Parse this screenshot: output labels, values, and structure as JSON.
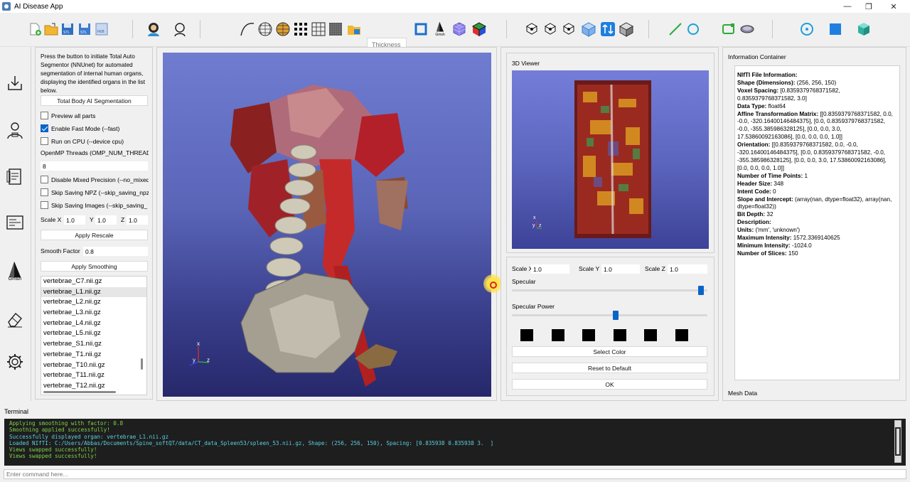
{
  "window": {
    "title": "AI Disease App",
    "controls": [
      "—",
      "❐",
      "✕"
    ]
  },
  "toolbar": {
    "thickness_placeholder": "Thickness",
    "gmsh_label": "Gmsh",
    "icons": [
      "new-file-icon",
      "open-folder-icon",
      "save-stl-icon",
      "save-stl-alt-icon",
      "save-feb-icon",
      "user-icon",
      "user-outline-icon",
      "spline-icon",
      "mesh-sphere-icon",
      "mesh-sphere-gold-icon",
      "voxel-grid-icon",
      "wireframe-grid-icon",
      "solid-grid-icon",
      "folder-open-icon",
      "crop-icon",
      "gmsh-icon",
      "cube-grid-icon",
      "color-cube-icon",
      "node-1-icon",
      "node-2-icon",
      "node-3-icon",
      "cube-icon",
      "swap-views-icon",
      "box-icon",
      "line-icon",
      "circle-icon",
      "rectangle-icon",
      "ellipse-icon",
      "target-icon",
      "square-icon",
      "cube-teal-icon"
    ]
  },
  "sidebar": {
    "items": [
      {
        "name": "download-icon"
      },
      {
        "name": "ai-doctor-icon"
      },
      {
        "name": "report-icon"
      },
      {
        "name": "log-icon"
      },
      {
        "name": "gmsh-icon",
        "label": "Gmsh"
      },
      {
        "name": "eraser-icon"
      },
      {
        "name": "settings-icon"
      }
    ]
  },
  "panel": {
    "description": "Press the button to initiate Total Auto Segmentor (NNUnet) for automated segmentation of internal human organs, displaying the identified organs in the list below.",
    "segment_button": "Total Body AI Segmentation",
    "checkboxes": [
      {
        "label": "Preview all parts",
        "checked": false
      },
      {
        "label": "Enable Fast Mode (--fast)",
        "checked": true
      },
      {
        "label": "Run on CPU (--device cpu)",
        "checked": false
      }
    ],
    "openmp_label": "OpenMP Threads (OMP_NUM_THREADS",
    "openmp_value": "8",
    "checkboxes2": [
      {
        "label": "Disable Mixed Precision (--no_mixed",
        "checked": false
      },
      {
        "label": "Skip Saving NPZ (--skip_saving_npz",
        "checked": false
      },
      {
        "label": "Skip Saving Images (--skip_saving_",
        "checked": false
      }
    ],
    "scale_x_label": "Scale X",
    "scale_x": "1.0",
    "scale_y_label": "Y",
    "scale_y": "1.0",
    "scale_z_label": "Z",
    "scale_z": "1.0",
    "rescale_button": "Apply Rescale",
    "smooth_label": "Smooth Factor",
    "smooth_value": "0.8",
    "smooth_button": "Apply Smoothing",
    "organs": [
      "vertebrae_C7.nii.gz",
      "vertebrae_L1.nii.gz",
      "vertebrae_L2.nii.gz",
      "vertebrae_L3.nii.gz",
      "vertebrae_L4.nii.gz",
      "vertebrae_L5.nii.gz",
      "vertebrae_S1.nii.gz",
      "vertebrae_T1.nii.gz",
      "vertebrae_T10.nii.gz",
      "vertebrae_T11.nii.gz",
      "vertebrae_T12.nii.gz"
    ],
    "selected_organ": 1
  },
  "main_view": {
    "axes": {
      "x": "x",
      "y": "y",
      "z": "z"
    }
  },
  "viewer": {
    "title": "3D Viewer",
    "axes": {
      "x": "x",
      "y": "y",
      "z": "z"
    },
    "scale_x_label": "Scale X",
    "scale_x": "1.0",
    "scale_y_label": "Scale Y",
    "scale_y": "1.0",
    "scale_z_label": "Scale Z",
    "scale_z": "1.0",
    "specular_label": "Specular",
    "specular_value": 0.98,
    "specular_power_label": "Specular Power",
    "specular_power_value": 0.53,
    "swatch_count": 6,
    "select_color_button": "Select Color",
    "reset_button": "Reset to Default",
    "ok_button": "OK"
  },
  "info": {
    "title": "Information Container",
    "mesh_label": "Mesh Data",
    "entries": [
      {
        "k": "NIfTI File Information:",
        "v": ""
      },
      {
        "k": "Shape (Dimensions):",
        "v": " (256, 256, 150)"
      },
      {
        "k": "Voxel Spacing:",
        "v": " [0.8359379768371582, 0.8359379768371582, 3.0]"
      },
      {
        "k": "Data Type:",
        "v": " float64"
      },
      {
        "k": "Affine Transformation Matrix:",
        "v": " [[0.8359379768371582, 0.0, -0.0, -320.16400146484375], [0.0, 0.8359379768371582, -0.0, -355.385986328125], [0.0, 0.0, 3.0, 17.53860092163086], [0.0, 0.0, 0.0, 1.0]]"
      },
      {
        "k": "Orientation:",
        "v": " [[0.8359379768371582, 0.0, -0.0, -320.16400146484375], [0.0, 0.8359379768371582, -0.0, -355.385986328125], [0.0, 0.0, 3.0, 17.53860092163086], [0.0, 0.0, 0.0, 1.0]]"
      },
      {
        "k": "Number of Time Points:",
        "v": " 1"
      },
      {
        "k": "Header Size:",
        "v": " 348"
      },
      {
        "k": "Intent Code:",
        "v": " 0"
      },
      {
        "k": "Slope and Intercept:",
        "v": " (array(nan, dtype=float32), array(nan, dtype=float32))"
      },
      {
        "k": "Bit Depth:",
        "v": " 32"
      },
      {
        "k": "Description:",
        "v": ""
      },
      {
        "k": "Units:",
        "v": " ('mm', 'unknown')"
      },
      {
        "k": "Maximum Intensity:",
        "v": " 1572.3369140625"
      },
      {
        "k": "Minimum Intensity:",
        "v": " -1024.0"
      },
      {
        "k": "Number of Slices:",
        "v": " 150"
      }
    ]
  },
  "terminal": {
    "label": "Terminal",
    "lines": [
      {
        "text": "Applying smoothing with factor: 0.8",
        "color": "#7fd34a"
      },
      {
        "text": "Smoothing applied successfully!",
        "color": "#7fd34a"
      },
      {
        "text": "Successfully displayed organ: vertebrae_L1.nii.gz",
        "color": "#5ad0e0"
      },
      {
        "text": "Loaded NIfTI: C:/Users/Abbas/Documents/Spine_softQT/data/CT_data_Spleen53/spleen_53.nii.gz, Shape: (256, 256, 150), Spacing: [0.835938 0.835938 3.  ]",
        "color": "#5ad0e0"
      },
      {
        "text": "Views swapped successfully!",
        "color": "#7fd34a"
      },
      {
        "text": "Views swapped successfully!",
        "color": "#7fd34a"
      }
    ],
    "command_placeholder": "Enter command here..."
  }
}
